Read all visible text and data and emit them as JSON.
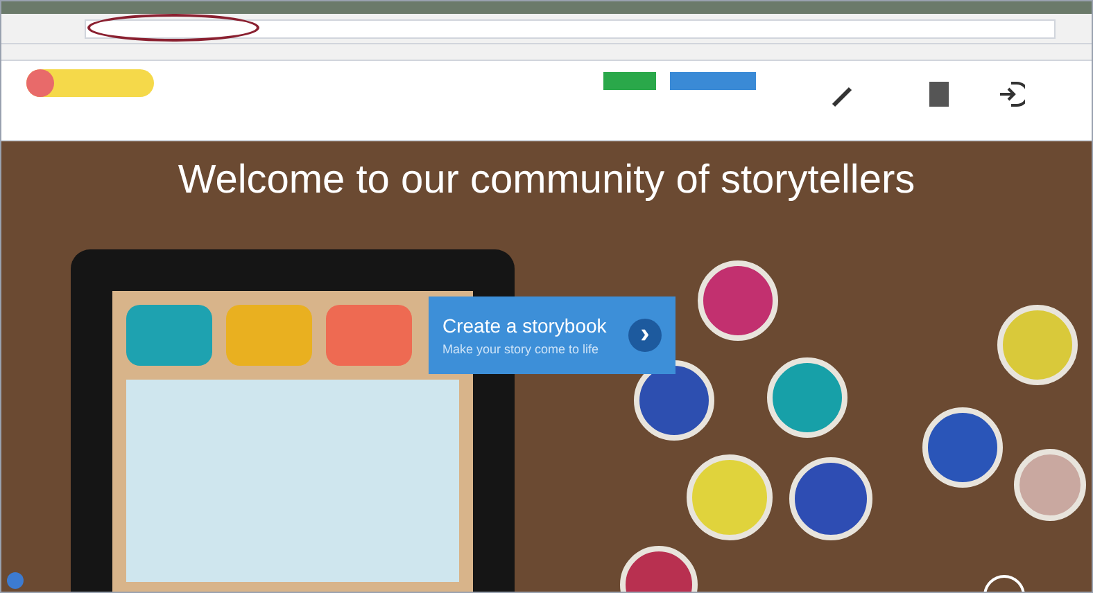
{
  "hero": {
    "heading": "Welcome to our community of storytellers"
  },
  "callout": {
    "title": "Create a storybook",
    "subtitle": "Make your story come to life",
    "arrow": "›"
  },
  "paints": [
    {
      "color": "#c2306f"
    },
    {
      "color": "#2d4fb0"
    },
    {
      "color": "#17a0a8"
    },
    {
      "color": "#d9c93a"
    },
    {
      "color": "#e0d33c"
    },
    {
      "color": "#2e4db3"
    },
    {
      "color": "#2a55b8"
    },
    {
      "color": "#c9a8a0"
    },
    {
      "color": "#b83050"
    }
  ]
}
